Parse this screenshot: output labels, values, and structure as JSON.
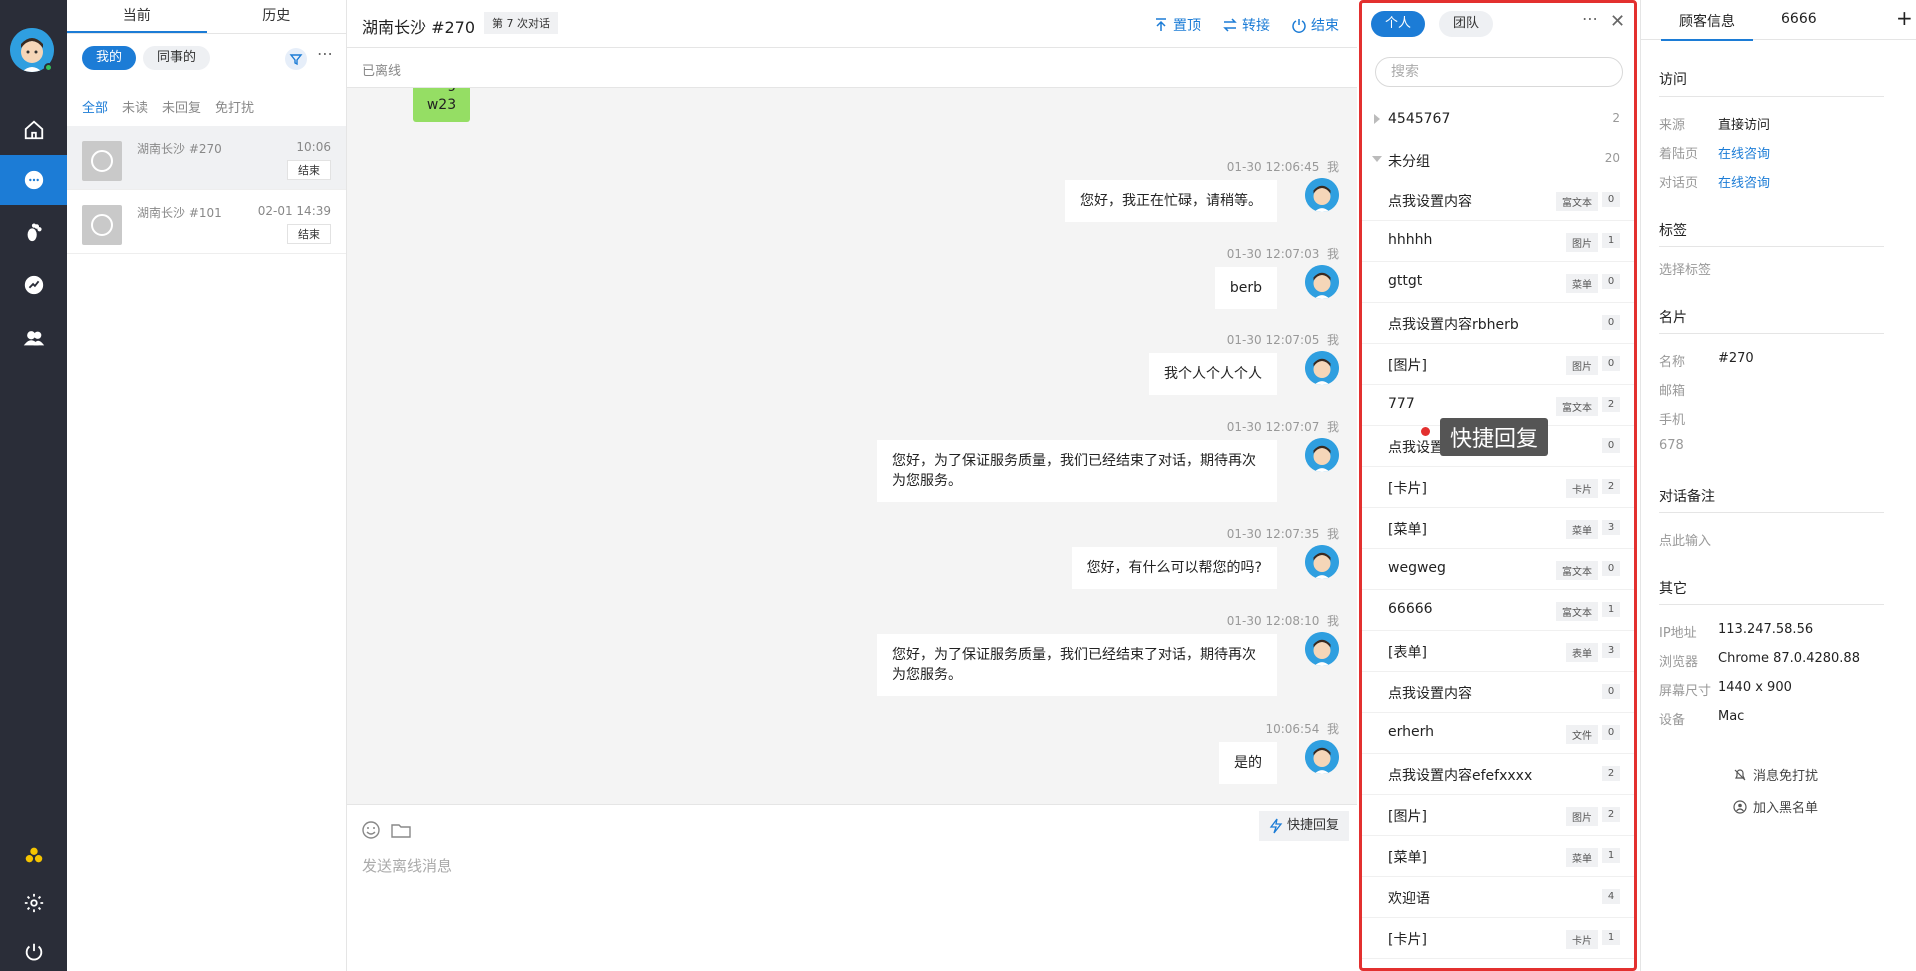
{
  "nav": {
    "items": [
      {
        "name": "home-icon"
      },
      {
        "name": "chat-icon",
        "active": true
      },
      {
        "name": "footprint-icon"
      },
      {
        "name": "stats-icon"
      },
      {
        "name": "users-icon"
      }
    ],
    "bottom": [
      {
        "name": "apps-icon"
      },
      {
        "name": "settings-icon"
      },
      {
        "name": "power-icon"
      }
    ]
  },
  "convlist": {
    "tabs": [
      "当前",
      "历史"
    ],
    "pills": [
      "我的",
      "同事的"
    ],
    "filters": [
      "全部",
      "未读",
      "未回复",
      "免打扰"
    ],
    "items": [
      {
        "name": "湖南长沙 #270",
        "time": "10:06",
        "action": "结束"
      },
      {
        "name": "湖南长沙 #101",
        "time": "02-01 14:39",
        "action": "结束"
      }
    ]
  },
  "chat": {
    "title": "湖南长沙 #270",
    "session_badge": "第 7 次对话",
    "actions": [
      "置顶",
      "转接",
      "结束"
    ],
    "status": "已离线",
    "partial_bubble": [
      "weg",
      "w23"
    ],
    "messages": [
      {
        "time": "01-30 12:06:45",
        "sender": "我",
        "text": "您好，我正在忙碌，请稍等。"
      },
      {
        "time": "01-30 12:07:03",
        "sender": "我",
        "text": "berb"
      },
      {
        "time": "01-30 12:07:05",
        "sender": "我",
        "text": "我个人个人个人"
      },
      {
        "time": "01-30 12:07:07",
        "sender": "我",
        "text": "您好，为了保证服务质量，我们已经结束了对话，期待再次为您服务。"
      },
      {
        "time": "01-30 12:07:35",
        "sender": "我",
        "text": "您好，有什么可以帮您的吗?"
      },
      {
        "time": "01-30 12:08:10",
        "sender": "我",
        "text": "您好，为了保证服务质量，我们已经结束了对话，期待再次为您服务。"
      },
      {
        "time": "10:06:54",
        "sender": "我",
        "text": "是的"
      }
    ],
    "composer": {
      "quick_reply_label": "快捷回复",
      "placeholder": "发送离线消息"
    }
  },
  "quick_reply": {
    "tabs": [
      "个人",
      "团队"
    ],
    "search_placeholder": "搜索",
    "groups": [
      {
        "label": "4545767",
        "count": "2",
        "expanded": false
      },
      {
        "label": "未分组",
        "count": "20",
        "expanded": true
      }
    ],
    "items": [
      {
        "label": "点我设置内容",
        "type": "富文本",
        "count": "0"
      },
      {
        "label": "hhhhh",
        "type": "图片",
        "count": "1"
      },
      {
        "label": "gttgt",
        "type": "菜单",
        "count": "0"
      },
      {
        "label": "点我设置内容rbherb",
        "type": "",
        "count": "0"
      },
      {
        "label": "[图片]",
        "type": "图片",
        "count": "0"
      },
      {
        "label": "777",
        "type": "富文本",
        "count": "2"
      },
      {
        "label": "点我设置内容",
        "type": "",
        "count": "0"
      },
      {
        "label": "[卡片]",
        "type": "卡片",
        "count": "2"
      },
      {
        "label": "[菜单]",
        "type": "菜单",
        "count": "3"
      },
      {
        "label": "wegweg",
        "type": "富文本",
        "count": "0"
      },
      {
        "label": "66666",
        "type": "富文本",
        "count": "1"
      },
      {
        "label": "[表单]",
        "type": "表单",
        "count": "3"
      },
      {
        "label": "点我设置内容",
        "type": "",
        "count": "0"
      },
      {
        "label": "erherh",
        "type": "文件",
        "count": "0"
      },
      {
        "label": "点我设置内容efefxxxx",
        "type": "",
        "count": "2"
      },
      {
        "label": "[图片]",
        "type": "图片",
        "count": "2"
      },
      {
        "label": "[菜单]",
        "type": "菜单",
        "count": "1"
      },
      {
        "label": "欢迎语",
        "type": "",
        "count": "4"
      },
      {
        "label": "[卡片]",
        "type": "卡片",
        "count": "1"
      }
    ],
    "tooltip": "快捷回复"
  },
  "info": {
    "tabs": [
      "顾客信息",
      "6666"
    ],
    "plus": "+",
    "visit": {
      "title": "访问",
      "rows": [
        {
          "k": "来源",
          "v": "直接访问",
          "link": false
        },
        {
          "k": "着陆页",
          "v": "在线咨询",
          "link": true
        },
        {
          "k": "对话页",
          "v": "在线咨询",
          "link": true
        }
      ]
    },
    "tags": {
      "title": "标签",
      "placeholder": "选择标签"
    },
    "card": {
      "title": "名片",
      "rows": [
        {
          "k": "名称",
          "v": "#270"
        },
        {
          "k": "邮箱",
          "v": ""
        },
        {
          "k": "手机",
          "v": ""
        },
        {
          "k": "678",
          "v": ""
        }
      ]
    },
    "note": {
      "title": "对话备注",
      "placeholder": "点此输入"
    },
    "other": {
      "title": "其它",
      "rows": [
        {
          "k": "IP地址",
          "v": "113.247.58.56"
        },
        {
          "k": "浏览器",
          "v": "Chrome 87.0.4280.88"
        },
        {
          "k": "屏幕尺寸",
          "v": "1440 x 900"
        },
        {
          "k": "设备",
          "v": "Mac"
        }
      ]
    },
    "actions": [
      "消息免打扰",
      "加入黑名单"
    ]
  }
}
